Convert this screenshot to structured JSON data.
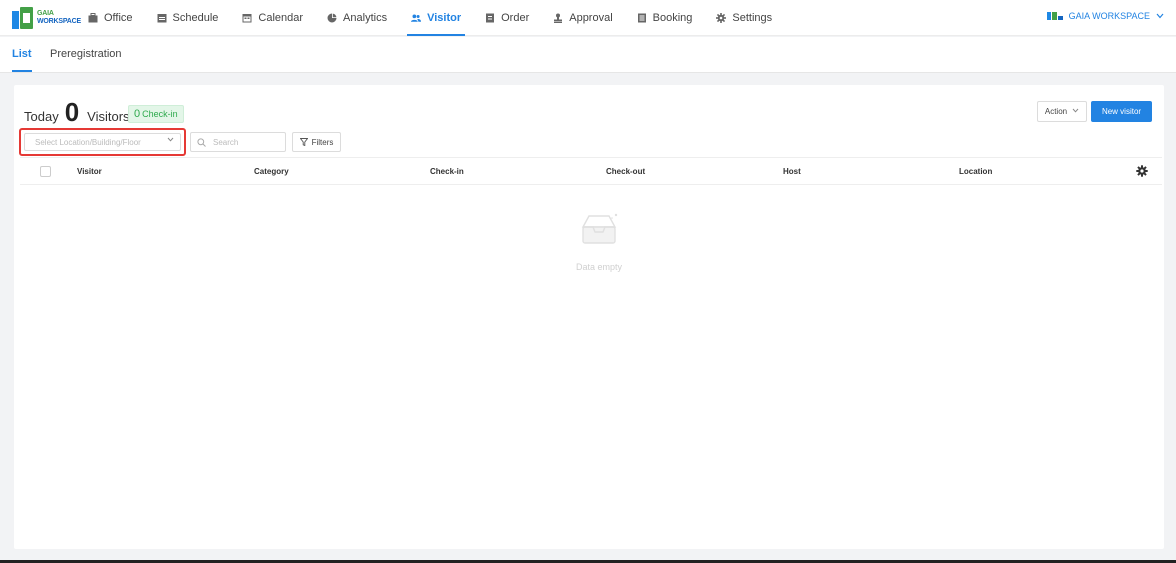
{
  "brand": {
    "line1": "GAIA",
    "line2": "WORKSPACE"
  },
  "nav": {
    "items": [
      {
        "label": "Office",
        "icon": "briefcase-icon",
        "active": false
      },
      {
        "label": "Schedule",
        "icon": "calendar-list-icon",
        "active": false
      },
      {
        "label": "Calendar",
        "icon": "calendar-icon",
        "active": false
      },
      {
        "label": "Analytics",
        "icon": "pie-chart-icon",
        "active": false
      },
      {
        "label": "Visitor",
        "icon": "users-icon",
        "active": true
      },
      {
        "label": "Order",
        "icon": "order-icon",
        "active": false
      },
      {
        "label": "Approval",
        "icon": "stamp-icon",
        "active": false
      },
      {
        "label": "Booking",
        "icon": "book-icon",
        "active": false
      },
      {
        "label": "Settings",
        "icon": "gear-icon",
        "active": false
      }
    ]
  },
  "workspace": {
    "label": "GAIA WORKSPACE"
  },
  "subtabs": [
    {
      "label": "List",
      "active": true
    },
    {
      "label": "Preregistration",
      "active": false
    }
  ],
  "summary": {
    "today_label": "Today",
    "count": "0",
    "visitors_label": "Visitors",
    "checkin_count": "0",
    "checkin_label": "Check-in"
  },
  "toolbar": {
    "action_label": "Action",
    "new_visitor_label": "New visitor",
    "location_placeholder": "Select Location/Building/Floor",
    "search_placeholder": "Search",
    "filters_label": "Filters"
  },
  "table": {
    "columns": [
      "Visitor",
      "Category",
      "Check-in",
      "Check-out",
      "Host",
      "Location"
    ],
    "rows": [],
    "empty_text": "Data empty"
  },
  "colors": {
    "accent": "#2283e2",
    "success": "#2eaa4d",
    "highlight_border": "#e53935"
  }
}
